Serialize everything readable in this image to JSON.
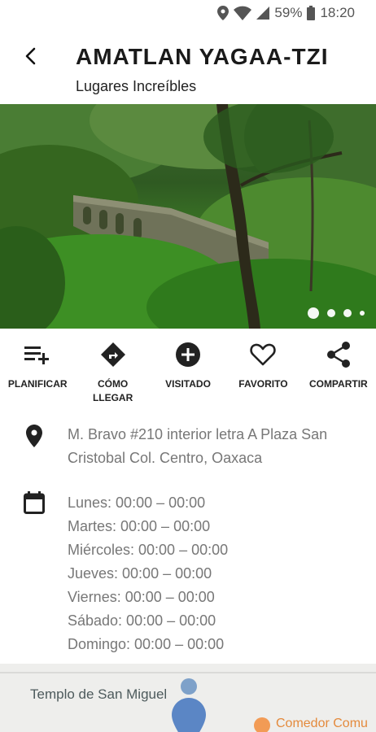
{
  "status_bar": {
    "battery": "59%",
    "time": "18:20"
  },
  "header": {
    "title": "AMATLAN YAGAA-TZI",
    "subtitle": "Lugares Increíbles"
  },
  "gallery": {
    "page_count": 4,
    "active_index": 0
  },
  "actions": [
    {
      "label": "PLANIFICAR",
      "icon": "playlist-add-icon"
    },
    {
      "label": "CÓMO LLEGAR",
      "icon": "directions-icon"
    },
    {
      "label": "VISITADO",
      "icon": "add-circle-icon"
    },
    {
      "label": "FAVORITO",
      "icon": "heart-outline-icon"
    },
    {
      "label": "COMPARTIR",
      "icon": "share-icon"
    }
  ],
  "address": {
    "line1": "M. Bravo #210 interior letra A Plaza San",
    "line2": "Cristobal Col. Centro, Oaxaca"
  },
  "hours": [
    "Lunes: 00:00 – 00:00",
    "Martes: 00:00 – 00:00",
    "Miércoles: 00:00 – 00:00",
    "Jueves: 00:00 – 00:00",
    "Viernes: 00:00 – 00:00",
    "Sábado: 00:00 – 00:00",
    "Domingo: 00:00 – 00:00"
  ],
  "map": {
    "place_label": "Templo de San Miguel",
    "poi_label": "Comedor Comu"
  },
  "colors": {
    "icon_dark": "#222222",
    "text_muted": "#777777",
    "map_bg": "#eeeeec",
    "pin": "#5b86c5",
    "poi_orange": "#e48a3c"
  }
}
